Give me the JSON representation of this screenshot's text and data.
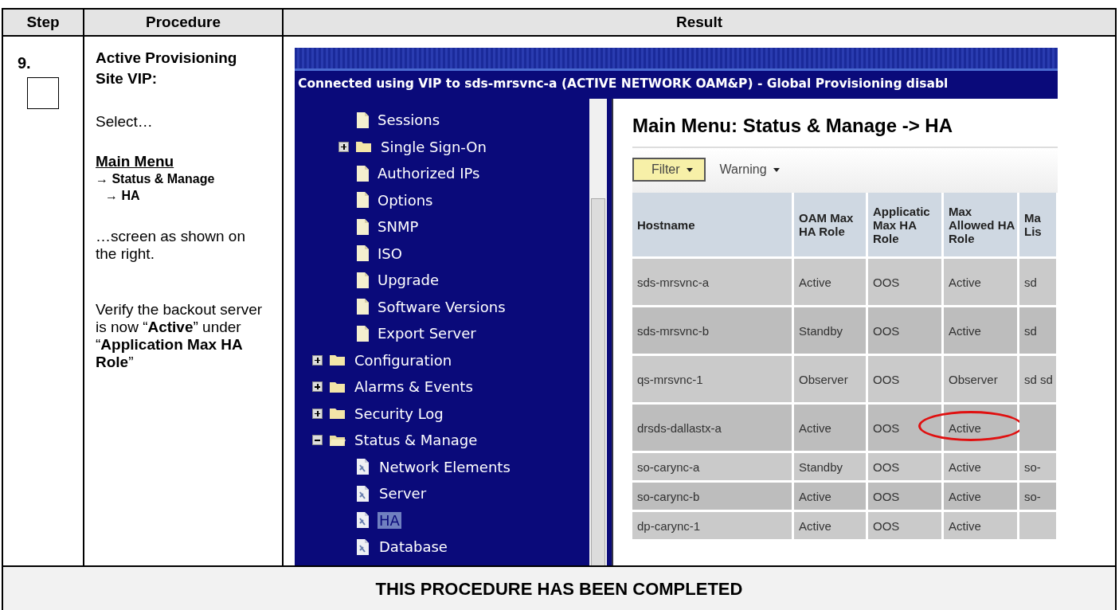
{
  "table": {
    "columns": [
      "Step",
      "Procedure",
      "Result"
    ],
    "step": {
      "number": "9.",
      "checked": false
    },
    "procedure": {
      "heading": "Active Provisioning Site VIP:",
      "select": "Select…",
      "menu": "Main Menu",
      "path": [
        "→ Status & Manage",
        "→ HA"
      ],
      "after": "…screen as shown on the right.",
      "verify": "Verify the backout server is now “**Active**” under “**Application Max HA Role**”"
    },
    "result": {
      "app": {
        "connection_banner": "Connected using VIP to sds-mrsvnc-a (ACTIVE NETWORK OAM&P) - Global Provisioning disabl",
        "tree": [
          {
            "children": [
              {
                "label": "Sessions",
                "kind": "page",
                "selected": false
              },
              {
                "label": "Single Sign-On",
                "kind": "folder",
                "expanded": false,
                "selected": false
              },
              {
                "label": "Authorized IPs",
                "kind": "page",
                "selected": false
              },
              {
                "label": "Options",
                "kind": "page",
                "selected": false
              },
              {
                "label": "SNMP",
                "kind": "page",
                "selected": false
              },
              {
                "label": "ISO",
                "kind": "page",
                "selected": false
              },
              {
                "label": "Upgrade",
                "kind": "page",
                "selected": false
              },
              {
                "label": "Software Versions",
                "kind": "page",
                "selected": false
              },
              {
                "label": "Export Server",
                "kind": "page",
                "selected": false
              }
            ]
          },
          {
            "label": "Configuration",
            "kind": "folder",
            "expanded": false,
            "selected": false
          },
          {
            "label": "Alarms & Events",
            "kind": "folder",
            "expanded": false,
            "selected": false
          },
          {
            "label": "Security Log",
            "kind": "folder",
            "expanded": false,
            "selected": false
          },
          {
            "label": "Status & Manage",
            "kind": "folder",
            "expanded": true,
            "selected": false,
            "children": [
              {
                "label": "Network Elements",
                "kind": "status-page",
                "selected": false
              },
              {
                "label": "Server",
                "kind": "status-page",
                "selected": false
              },
              {
                "label": "HA",
                "kind": "status-page",
                "selected": true
              },
              {
                "label": "Database",
                "kind": "status-page",
                "selected": false
              }
            ]
          }
        ],
        "page_title": "Main Menu: Status & Manage -> HA",
        "filter_button": "Filter",
        "warning_menu": "Warning",
        "ha_table": {
          "columns": [
            "Hostname",
            "OAM Max HA Role",
            "Applicatic Max HA Role",
            "Max Allowed HA Role",
            "Ma Lis"
          ],
          "rows": [
            {
              "circled": false,
              "cells": [
                "sds-mrsvnc-a",
                "Active",
                "OOS",
                "Active",
                "sd"
              ]
            },
            {
              "circled": false,
              "cells": [
                "sds-mrsvnc-b",
                "Standby",
                "OOS",
                "Active",
                "sd"
              ]
            },
            {
              "circled": false,
              "cells": [
                "qs-mrsvnc-1",
                "Observer",
                "OOS",
                "Observer",
                "sd sd"
              ]
            },
            {
              "circled": true,
              "cells": [
                "drsds-dallastx-a",
                "Active",
                "OOS",
                "Active",
                ""
              ]
            },
            {
              "circled": false,
              "cells": [
                "so-carync-a",
                "Standby",
                "OOS",
                "Active",
                "so-"
              ]
            },
            {
              "circled": false,
              "cells": [
                "so-carync-b",
                "Active",
                "OOS",
                "Active",
                "so-"
              ]
            },
            {
              "circled": false,
              "cells": [
                "dp-carync-1",
                "Active",
                "OOS",
                "Active",
                ""
              ]
            }
          ]
        }
      }
    },
    "footer": "THIS PROCEDURE HAS BEEN COMPLETED"
  }
}
